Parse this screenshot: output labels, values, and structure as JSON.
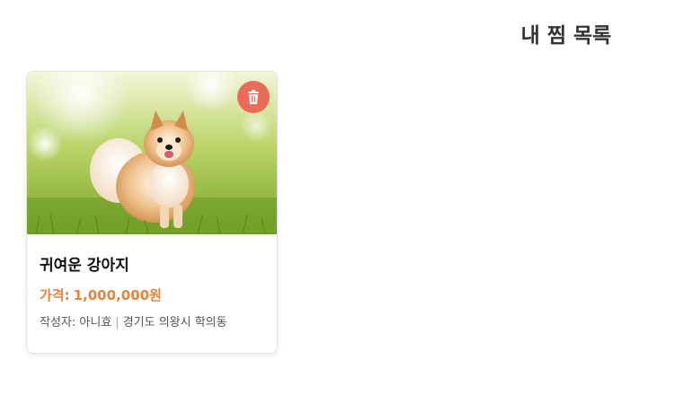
{
  "page": {
    "title": "내 찜 목록"
  },
  "wishlist": {
    "items": [
      {
        "title": "귀여운 강아지",
        "price_label": "가격:",
        "price": "1,000,000원",
        "author_label": "작성자:",
        "author": "아니효",
        "location": "경기도 의왕시 학의동",
        "image": "pomeranian-dog-on-grass",
        "delete_icon": "trash-icon"
      }
    ]
  },
  "colors": {
    "accent_price": "#e8843a",
    "delete_button": "#ec6a58",
    "title_text": "#333333"
  }
}
